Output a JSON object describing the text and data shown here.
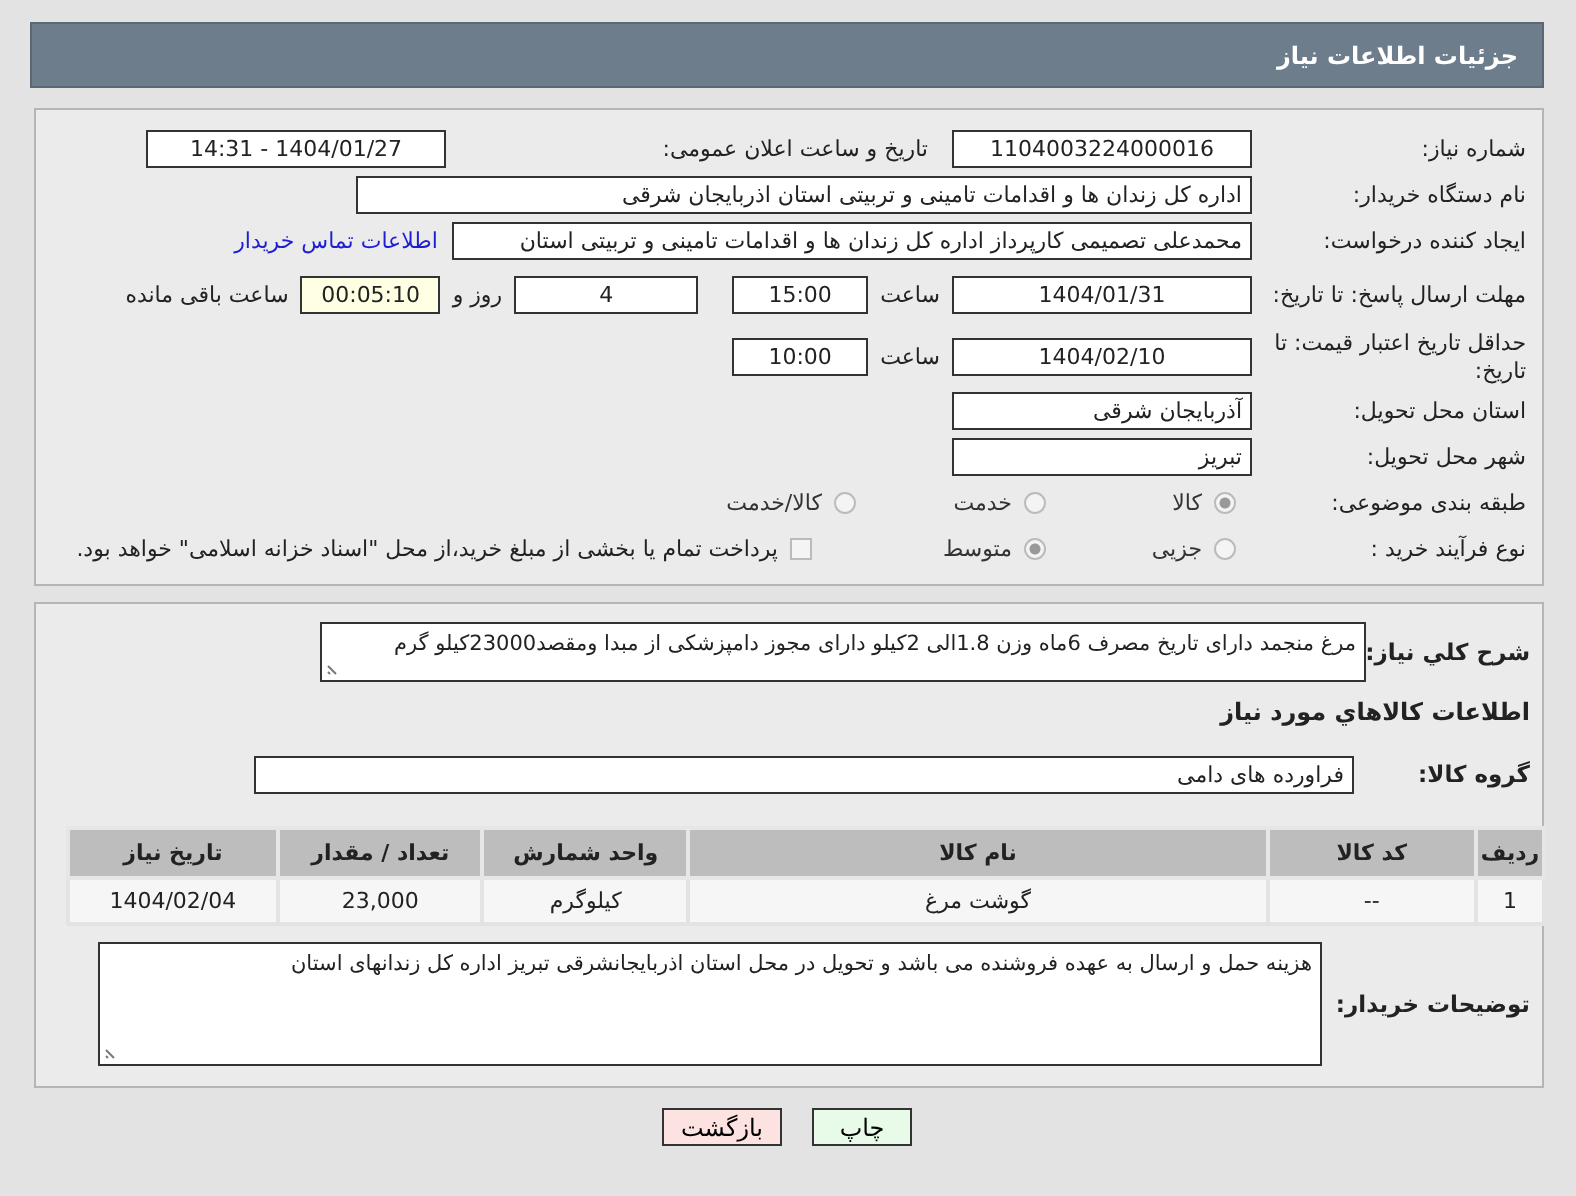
{
  "header": {
    "title": "جزئیات اطلاعات نیاز"
  },
  "need_number": {
    "label": "شماره نیاز:",
    "value": "1104003224000016"
  },
  "announcement": {
    "label": "تاریخ و ساعت اعلان عمومی:",
    "value": "1404/01/27 - 14:31"
  },
  "buyer": {
    "label": "نام دستگاه خریدار:",
    "value": "اداره کل زندان ها و اقدامات تامینی و تربیتی استان اذربایجان شرقی"
  },
  "requester": {
    "label": "ایجاد کننده درخواست:",
    "value": "محمدعلی تصمیمی کارپرداز اداره کل زندان ها و اقدامات تامینی و تربیتی استان",
    "link": "اطلاعات تماس خریدار"
  },
  "deadline": {
    "label": "مهلت ارسال پاسخ: تا تاریخ:",
    "date": "1404/01/31",
    "time_label": "ساعت",
    "time": "15:00",
    "days": "4",
    "days_label": "روز و",
    "remaining": "00:05:10",
    "remaining_label": "ساعت باقی مانده"
  },
  "validity": {
    "label": "حداقل تاریخ اعتبار قیمت: تا تاریخ:",
    "date": "1404/02/10",
    "time_label": "ساعت",
    "time": "10:00"
  },
  "province": {
    "label": "استان محل تحویل:",
    "value": "آذربایجان شرقی"
  },
  "city": {
    "label": "شهر محل تحویل:",
    "value": "تبریز"
  },
  "category": {
    "label": "طبقه بندی موضوعی:",
    "options": [
      {
        "label": "کالا",
        "selected": true
      },
      {
        "label": "خدمت",
        "selected": false
      },
      {
        "label": "کالا/خدمت",
        "selected": false
      }
    ]
  },
  "process": {
    "label": "نوع فرآیند خرید :",
    "options": [
      {
        "label": "جزیی",
        "selected": false
      },
      {
        "label": "متوسط",
        "selected": true
      }
    ],
    "payment": {
      "label": "پرداخت تمام یا بخشی از مبلغ خرید،از محل \"اسناد خزانه اسلامی\" خواهد بود.",
      "checked": false
    }
  },
  "description": {
    "label": "شرح كلي نياز:",
    "value": "مرغ منجمد دارای تاریخ مصرف 6ماه وزن 1.8الی 2کیلو دارای مجوز دامپزشکی از مبدا ومقصد23000کیلو گرم"
  },
  "goods_heading": "اطلاعات كالاهاي مورد نياز",
  "goods_group": {
    "label": "گروه كالا:",
    "value": "فراورده های دامی"
  },
  "table": {
    "columns": [
      "ردیف",
      "کد کالا",
      "نام کالا",
      "واحد شمارش",
      "تعداد / مقدار",
      "تاریخ نیاز"
    ],
    "rows": [
      [
        "1",
        "--",
        "گوشت مرغ",
        "کیلوگرم",
        "23,000",
        "1404/02/04"
      ]
    ]
  },
  "buyer_notes": {
    "label": "توضیحات خریدار:",
    "value": "هزینه حمل و ارسال به عهده فروشنده می باشد و تحویل در محل استان اذربایجانشرقی تبریز اداره کل زندانهای استان"
  },
  "buttons": [
    {
      "label": "چاپ",
      "kind": "print"
    },
    {
      "label": "بازگشت",
      "kind": "back"
    }
  ]
}
